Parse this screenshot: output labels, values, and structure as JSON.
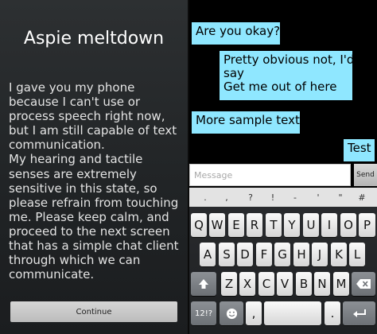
{
  "left": {
    "title": "Aspie meltdown",
    "message": "I gave you my phone\nbecause I can't use or\nprocess speech right now,\nbut I am still capable of text\ncommunication.\nMy hearing and tactile\nsenses are extremely\nsensitive in this state, so\nplease refrain from touching\nme. Please keep calm, and\nproceed to the next screen\nthat has a simple chat client\nthrough which we can\ncommunicate.",
    "continue_label": "Continue"
  },
  "chat": {
    "messages": [
      {
        "text": "Are you okay?",
        "side": "left"
      },
      {
        "text": "Pretty obvious not, I'd\nsay\nGet me out of here",
        "side": "right"
      },
      {
        "text": "More sample text",
        "side": "left"
      },
      {
        "text": "Test",
        "side": "right"
      }
    ],
    "bubble_color": "#8fe7ff",
    "input_placeholder": "Message",
    "input_value": "",
    "send_label": "Send"
  },
  "keyboard": {
    "symbols": [
      ".",
      ",",
      "?",
      "!",
      "-",
      "'",
      "\"",
      "#"
    ],
    "row1": [
      "Q",
      "W",
      "E",
      "R",
      "T",
      "Y",
      "U",
      "I",
      "O",
      "P"
    ],
    "row2": [
      "A",
      "S",
      "D",
      "F",
      "G",
      "H",
      "J",
      "K",
      "L"
    ],
    "row3": [
      "Z",
      "X",
      "C",
      "V",
      "B",
      "N",
      "M"
    ],
    "numbers_label": "12!?",
    "comma": ",",
    "period": ".",
    "icons": {
      "shift": "shift-icon",
      "backspace": "backspace-icon",
      "emoji": "smiley-icon",
      "enter": "enter-icon"
    }
  }
}
